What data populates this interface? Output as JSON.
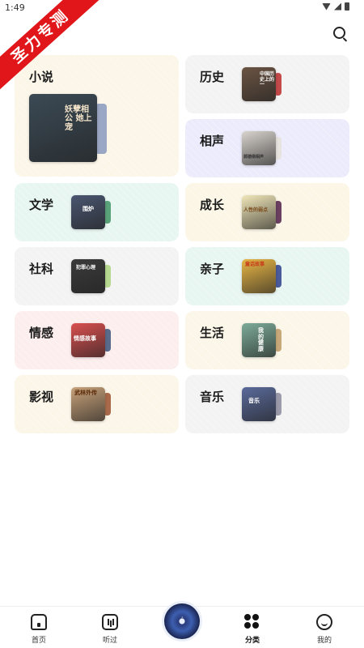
{
  "status": {
    "time": "1:49"
  },
  "ribbon": {
    "text": "圣力专测"
  },
  "categories": [
    {
      "label": "小说",
      "bg": "#fbf6e8",
      "cover_title": "妖孽相公 她上宠",
      "cover_color": "#3b4a55",
      "back_color": "#9aa7c4"
    },
    {
      "label": "历史",
      "bg": "#f3f3f3",
      "cover_title": "中国历史上的一",
      "cover_color": "#6b5443",
      "back_color": "#c44a4a"
    },
    {
      "label": "相声",
      "bg": "#ecebfb",
      "cover_title": "郭德纲相声",
      "cover_color": "#d8d3cd",
      "back_color": "#e7e3df"
    },
    {
      "label": "文学",
      "bg": "#e8f6f2",
      "cover_title": "围炉",
      "cover_color": "#4a5670",
      "back_color": "#5aa27a"
    },
    {
      "label": "成长",
      "bg": "#fbf6e6",
      "cover_title": "人性的弱点",
      "cover_color": "#f1e7b9",
      "back_color": "#6a3f60"
    },
    {
      "label": "社科",
      "bg": "#f3f3f3",
      "cover_title": "犯罪心理",
      "cover_color": "#3b3b3b",
      "back_color": "#b7d890"
    },
    {
      "label": "亲子",
      "bg": "#e8f6f2",
      "cover_title": "童话故事",
      "cover_color": "#e7b545",
      "back_color": "#4a5a9a"
    },
    {
      "label": "情感",
      "bg": "#fdeeee",
      "cover_title": "情感故事",
      "cover_color": "#d9504f",
      "back_color": "#5a6a8a"
    },
    {
      "label": "生活",
      "bg": "#fbf6e8",
      "cover_title": "我的健康",
      "cover_color": "#7dab99",
      "back_color": "#c8a878"
    },
    {
      "label": "影视",
      "bg": "#fbf6e8",
      "cover_title": "武林外传",
      "cover_color": "#c8a27a",
      "back_color": "#a86a4a"
    },
    {
      "label": "音乐",
      "bg": "#f3f3f3",
      "cover_title": "音乐",
      "cover_color": "#5a6a9a",
      "back_color": "#9a9aaa"
    }
  ],
  "nav": [
    {
      "label": "首页",
      "icon": "home-icon"
    },
    {
      "label": "听过",
      "icon": "listened-icon"
    },
    {
      "label": "",
      "icon": "player-disc-icon"
    },
    {
      "label": "分类",
      "icon": "category-icon"
    },
    {
      "label": "我的",
      "icon": "profile-icon"
    }
  ]
}
